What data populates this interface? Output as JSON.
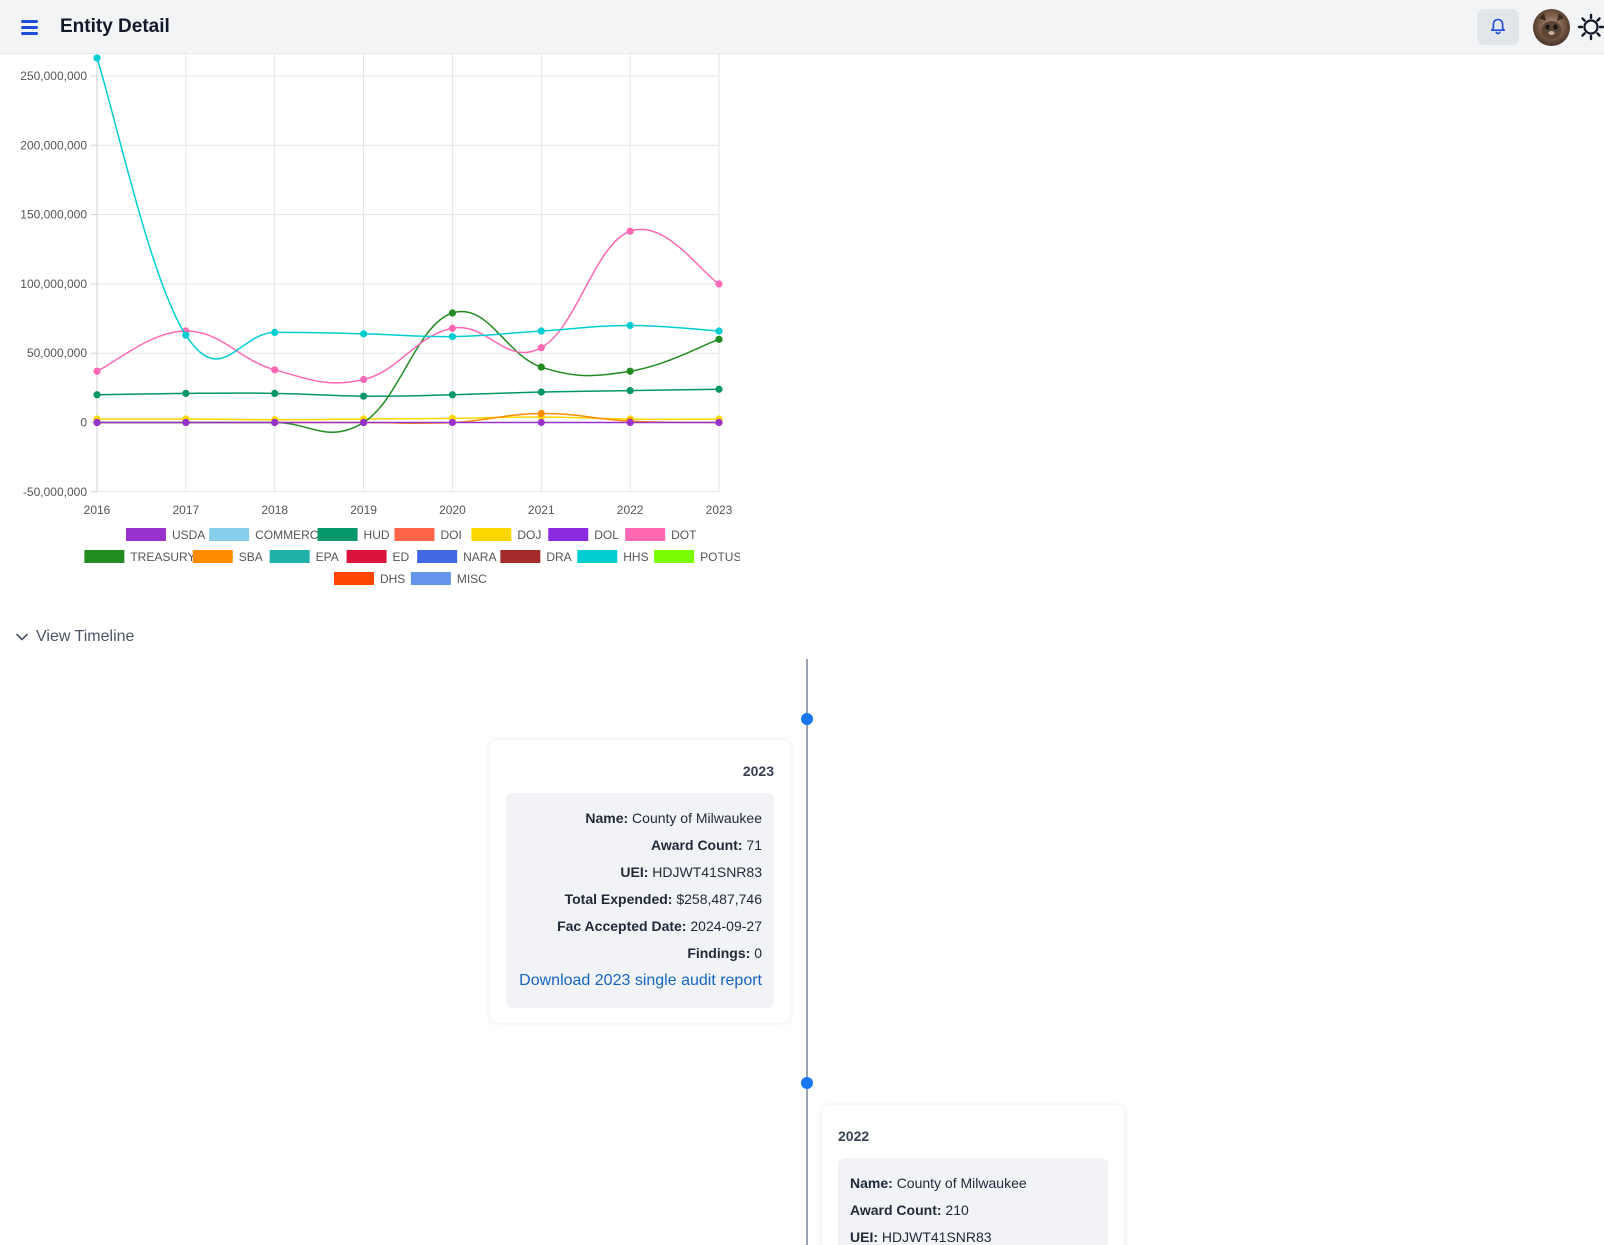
{
  "header": {
    "title": "Entity Detail",
    "menu_icon": "hamburger-menu-icon",
    "bell_icon": "bell-icon",
    "theme_icon": "sun-icon"
  },
  "chart_data": {
    "type": "line",
    "x": [
      2016,
      2017,
      2018,
      2019,
      2020,
      2021,
      2022,
      2023
    ],
    "y_ticks": [
      "250,000,000",
      "200,000,000",
      "150,000,000",
      "100,000,000",
      "50,000,000",
      "0",
      "-50,000,000"
    ],
    "ylim": [
      -50000000,
      260000000
    ],
    "grid": true,
    "legend_position": "bottom",
    "legend": [
      {
        "name": "USDA",
        "color": "#9932CC"
      },
      {
        "name": "COMMERCE",
        "color": "#87CEEB"
      },
      {
        "name": "HUD",
        "color": "#059669"
      },
      {
        "name": "DOI",
        "color": "#FF6347"
      },
      {
        "name": "DOJ",
        "color": "#FFD700"
      },
      {
        "name": "DOL",
        "color": "#8A2BE2"
      },
      {
        "name": "DOT",
        "color": "#FF69B4"
      },
      {
        "name": "TREASURY",
        "color": "#228B22"
      },
      {
        "name": "SBA",
        "color": "#FF8C00"
      },
      {
        "name": "EPA",
        "color": "#20B2AA"
      },
      {
        "name": "ED",
        "color": "#DC143C"
      },
      {
        "name": "NARA",
        "color": "#4169E1"
      },
      {
        "name": "DRA",
        "color": "#A52A2A"
      },
      {
        "name": "HHS",
        "color": "#00CED1"
      },
      {
        "name": "POTUS",
        "color": "#7CFC00"
      },
      {
        "name": "DHS",
        "color": "#FF4500"
      },
      {
        "name": "MISC",
        "color": "#6495ED"
      }
    ],
    "series": [
      {
        "name": "HHS",
        "color": "#00CED1",
        "values": [
          263000000,
          63000000,
          65000000,
          64000000,
          62000000,
          66000000,
          70000000,
          66000000
        ]
      },
      {
        "name": "DOT",
        "color": "#FF69B4",
        "values": [
          37000000,
          66000000,
          38000000,
          31000000,
          68000000,
          54000000,
          138000000,
          100000000
        ]
      },
      {
        "name": "TREASURY",
        "color": "#228B22",
        "values": [
          0,
          0,
          0,
          0,
          79000000,
          40000000,
          37000000,
          60000000
        ]
      },
      {
        "name": "HUD",
        "color": "#059669",
        "values": [
          20000000,
          21000000,
          21000000,
          19000000,
          20000000,
          22000000,
          23000000,
          24000000
        ]
      },
      {
        "name": "DOJ",
        "color": "#FFD700",
        "values": [
          2500000,
          2500000,
          2000000,
          2500000,
          3000000,
          4000000,
          2500000,
          2500000
        ]
      },
      {
        "name": "SBA",
        "color": "#FF8C00",
        "values": [
          0,
          0,
          0,
          0,
          0,
          6500000,
          1000000,
          0
        ]
      },
      {
        "name": "USDA",
        "color": "#9932CC",
        "values": [
          0,
          0,
          0,
          0,
          0,
          0,
          0,
          0
        ]
      }
    ]
  },
  "timeline": {
    "toggle_label": "View Timeline",
    "toggle_icon": "chevron-down-icon",
    "entries": [
      {
        "year": "2023",
        "name_label": "Name:",
        "name": "County of Milwaukee",
        "award_count_label": "Award Count:",
        "award_count": "71",
        "uei_label": "UEI:",
        "uei": "HDJWT41SNR83",
        "total_expended_label": "Total Expended:",
        "total_expended": "$258,487,746",
        "fac_date_label": "Fac Accepted Date:",
        "fac_date": "2024-09-27",
        "findings_label": "Findings:",
        "findings": "0",
        "download_link": "Download 2023 single audit report"
      },
      {
        "year": "2022",
        "name_label": "Name:",
        "name": "County of Milwaukee",
        "award_count_label": "Award Count:",
        "award_count": "210",
        "uei_label": "UEI:",
        "uei": "HDJWT41SNR83"
      }
    ]
  }
}
